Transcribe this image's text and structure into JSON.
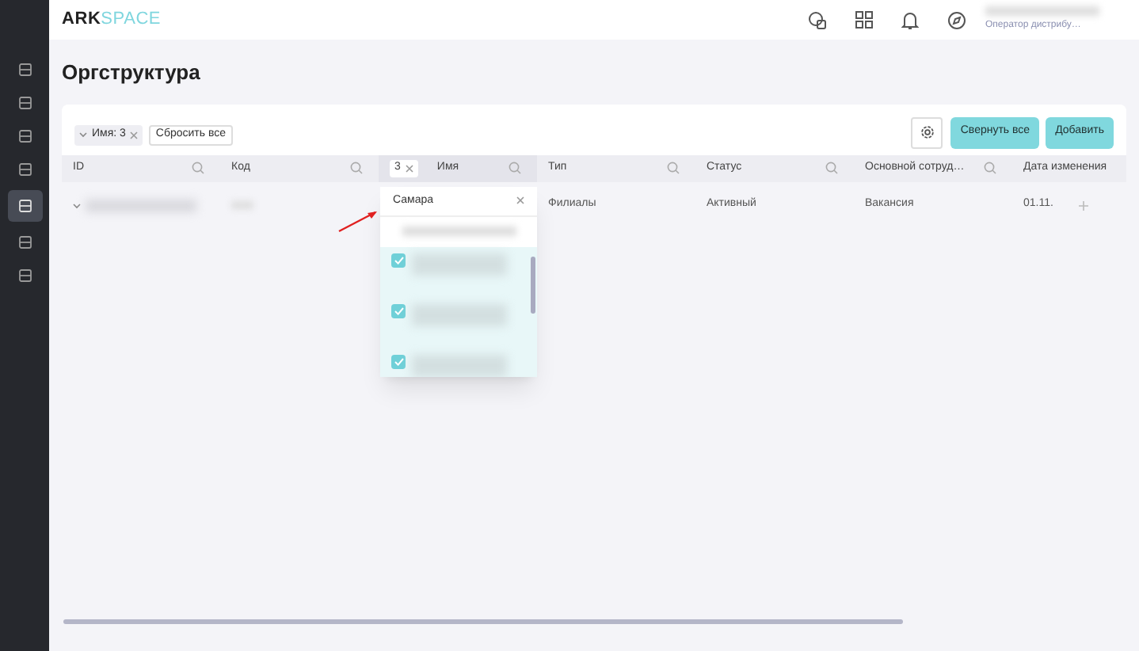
{
  "logo": {
    "part_1": "ARK",
    "part_2": "SPACE"
  },
  "sidebar": {
    "items": [
      {
        "selected": false
      },
      {
        "selected": false
      },
      {
        "selected": false
      },
      {
        "selected": false
      },
      {
        "selected": true
      },
      {
        "selected": false
      },
      {
        "selected": false
      }
    ]
  },
  "user": {
    "role": "Оператор дистрибу…"
  },
  "page_title": "Оргструктура",
  "filters": {
    "chips": [
      {
        "label": "Имя: 3"
      }
    ],
    "reset": "Сбросить все"
  },
  "toolbar": {
    "buttons": [
      "Свернуть все",
      "Добавить"
    ]
  },
  "table": {
    "columns": [
      {
        "label": "ID"
      },
      {
        "label": "Код"
      },
      {
        "label": "Имя",
        "filter": "3"
      },
      {
        "label": "Тип"
      },
      {
        "label": "Статус"
      },
      {
        "label": "Основной сотруд…"
      },
      {
        "label": "Дата изменения"
      }
    ],
    "rows": [
      {
        "type": "Филиалы",
        "status": "Активный",
        "employee": "Вакансия",
        "date": "01.11."
      }
    ]
  },
  "name_filter": {
    "value": "Самара",
    "options": [
      {
        "checked": true
      },
      {
        "checked": true
      },
      {
        "checked": true
      }
    ]
  }
}
